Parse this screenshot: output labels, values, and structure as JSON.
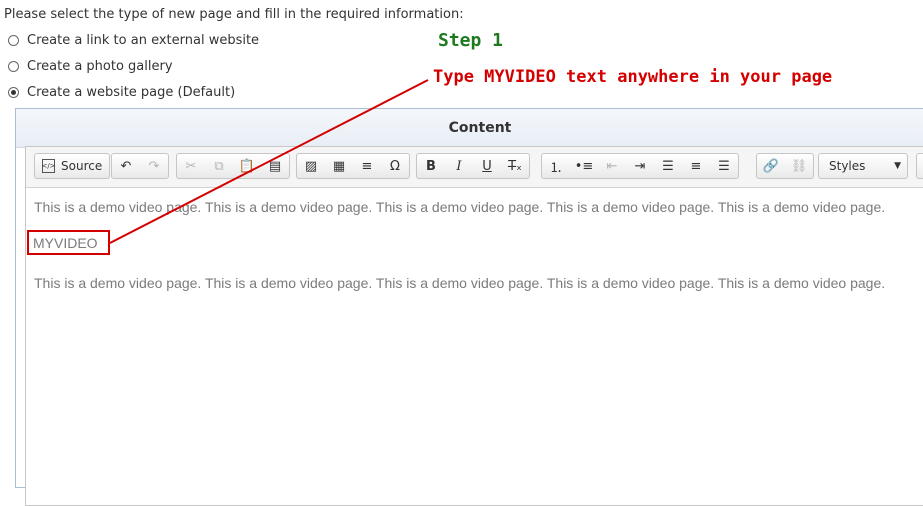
{
  "intro_text": "Please select the type of new page and fill in the required information:",
  "page_types": [
    {
      "label": "Create a link to an external website",
      "selected": false
    },
    {
      "label": "Create a photo gallery",
      "selected": false
    },
    {
      "label": "Create a website page (Default)",
      "selected": true
    }
  ],
  "annotations": {
    "step": "Step 1",
    "instruction": "Type MYVIDEO text anywhere in your page"
  },
  "panel": {
    "title": "Content"
  },
  "toolbar": {
    "source_label": "Source",
    "styles_value": "Styles",
    "icons": [
      "undo-icon",
      "redo-icon",
      "cut-icon",
      "copy-icon",
      "paste-icon",
      "paste-text-icon",
      "image-icon",
      "table-icon",
      "horizontal-line-icon",
      "special-char-icon",
      "bold-icon",
      "italic-icon",
      "underline-icon",
      "remove-format-icon",
      "numbered-list-icon",
      "bulleted-list-icon",
      "outdent-icon",
      "indent-icon",
      "align-left-icon",
      "align-center-icon",
      "align-right-icon",
      "link-icon",
      "unlink-icon"
    ]
  },
  "editor": {
    "paragraph_1": "This is a demo video page. This is a demo video page. This is a demo video page. This is a demo video page. This is a demo video page.",
    "keyword": "MYVIDEO",
    "paragraph_2": "This is a demo video page. This is a demo video page. This is a demo video page. This is a demo video page. This is a demo video page."
  },
  "colors": {
    "step": "#1e7a1e",
    "annotation": "#d40000",
    "panel_border": "#a9bfd6"
  }
}
